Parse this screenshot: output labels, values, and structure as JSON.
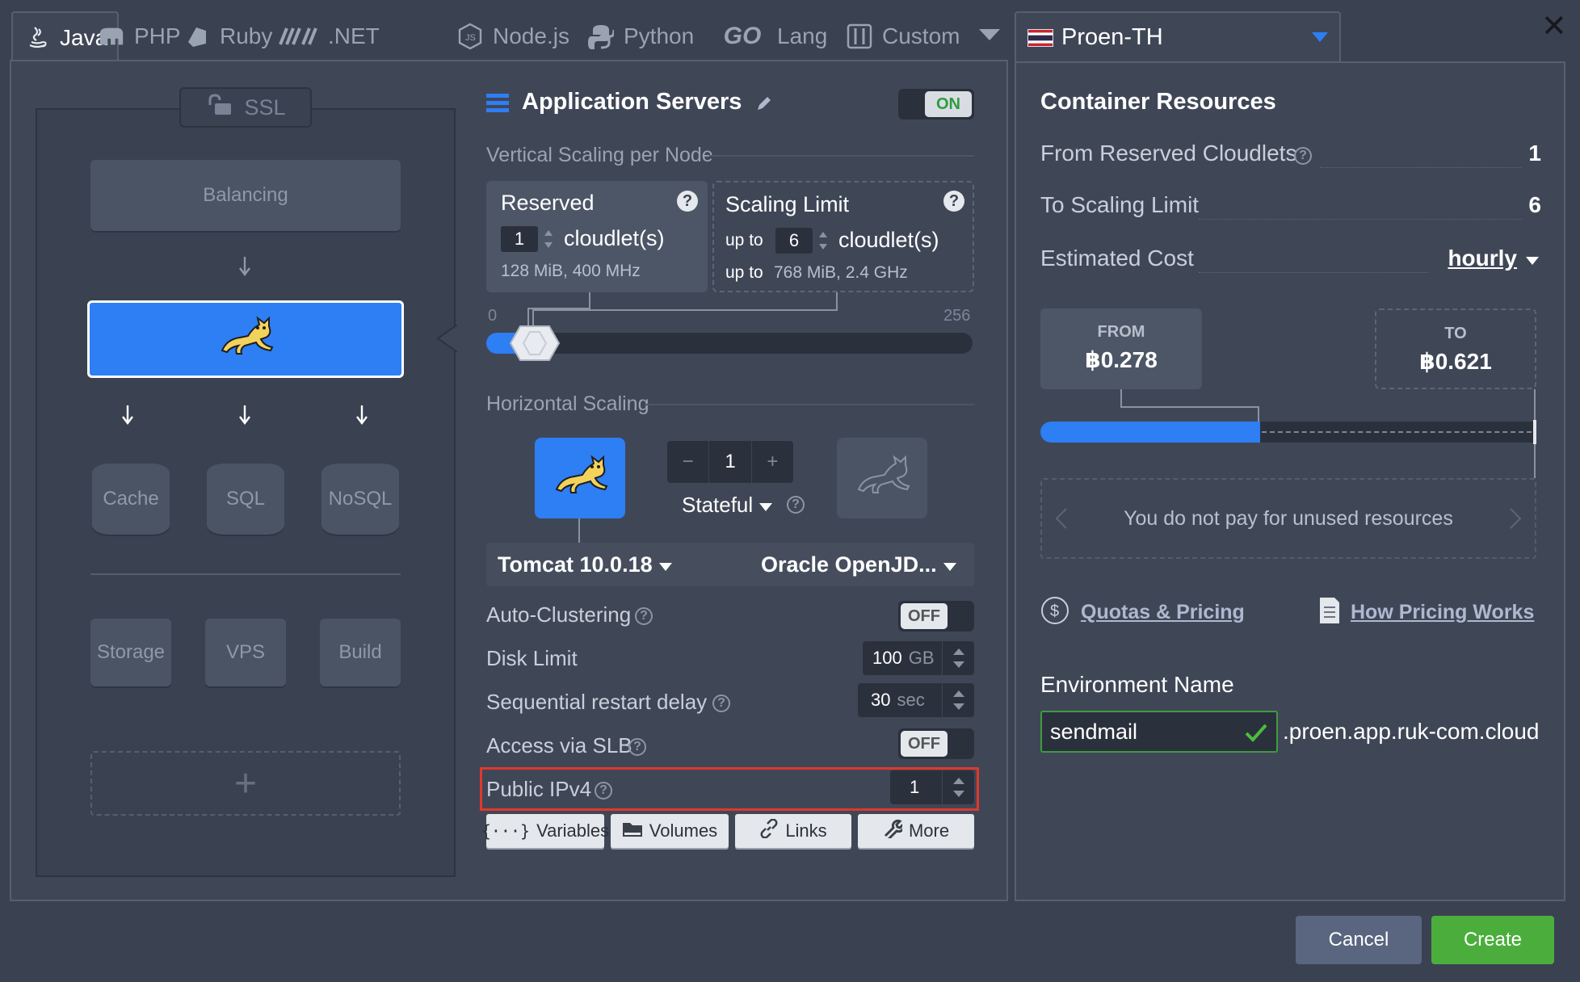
{
  "tabs": [
    {
      "label": "Java",
      "icon": "java-icon",
      "active": true
    },
    {
      "label": "PHP",
      "icon": "elephant-icon"
    },
    {
      "label": "Ruby",
      "icon": "ruby-icon"
    },
    {
      "label": ".NET",
      "icon": "dotnet-icon"
    },
    {
      "label": "Node.js",
      "icon": "nodejs-icon"
    },
    {
      "label": "Python",
      "icon": "python-icon"
    },
    {
      "label": "Lang",
      "icon": "go-icon",
      "icon_text": "GO"
    },
    {
      "label": "Custom",
      "icon": "custom-icon"
    }
  ],
  "region": {
    "name": "Proen-TH",
    "flag": "thailand-flag-icon"
  },
  "topology": {
    "ssl_label": "SSL",
    "balancing_label": "Balancing",
    "cache_label": "Cache",
    "sql_label": "SQL",
    "nosql_label": "NoSQL",
    "storage_label": "Storage",
    "vps_label": "VPS",
    "build_label": "Build",
    "add_symbol": "+"
  },
  "app_servers": {
    "title": "Application Servers",
    "toggle": "ON",
    "vertical_label": "Vertical Scaling per Node",
    "reserved": {
      "title": "Reserved",
      "value": "1",
      "unit": "cloudlet(s)",
      "spec": "128 MiB, 400 MHz"
    },
    "limit": {
      "title": "Scaling Limit",
      "prefix": "up to",
      "value": "6",
      "unit": "cloudlet(s)",
      "spec_prefix": "up to",
      "spec": "768 MiB, 2.4 GHz"
    },
    "slider_min": "0",
    "slider_max": "256",
    "horizontal_label": "Horizontal Scaling",
    "node_count": "1",
    "minus": "−",
    "plus": "+",
    "mode": "Stateful",
    "stack": "Tomcat 10.0.18",
    "jdk": "Oracle OpenJD...",
    "auto_clustering": {
      "label": "Auto-Clustering",
      "value": "OFF"
    },
    "disk_limit": {
      "label": "Disk Limit",
      "value": "100",
      "unit": "GB"
    },
    "restart_delay": {
      "label": "Sequential restart delay",
      "value": "30",
      "unit": "sec"
    },
    "slb": {
      "label": "Access via SLB",
      "value": "OFF"
    },
    "ipv4": {
      "label": "Public IPv4",
      "value": "1"
    },
    "buttons": {
      "variables": "Variables",
      "volumes": "Volumes",
      "links": "Links",
      "more": "More"
    }
  },
  "resources": {
    "title": "Container Resources",
    "from_label": "From Reserved Cloudlets",
    "from_value": "1",
    "to_label": "To Scaling Limit",
    "to_value": "6",
    "cost_label": "Estimated Cost",
    "cost_period": "hourly",
    "from_head": "FROM",
    "from_price": "฿0.278",
    "to_head": "TO",
    "to_price": "฿0.621",
    "unused_text": "You do not pay for unused resources",
    "quotas_link": "Quotas & Pricing",
    "how_link": "How Pricing Works"
  },
  "environment": {
    "label": "Environment Name",
    "value": "sendmail",
    "domain_suffix": ".proen.app.ruk-com.cloud"
  },
  "footer": {
    "cancel": "Cancel",
    "create": "Create"
  },
  "colors": {
    "accent": "#2e7ef4",
    "create": "#4bae3c",
    "highlight": "#e0382b",
    "on": "#2e9b3e"
  }
}
